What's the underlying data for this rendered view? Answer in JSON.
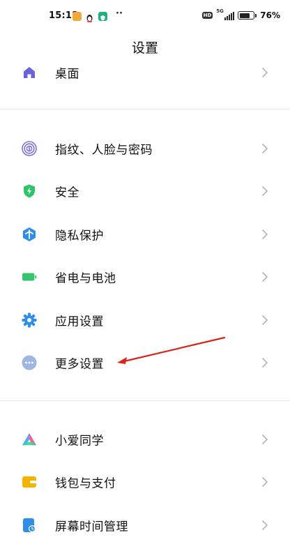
{
  "status_bar": {
    "time": "15:13",
    "dots": "··",
    "hd": "HD",
    "network": "5G",
    "battery_percent": "76%",
    "battery_level": 0.76
  },
  "page": {
    "title": "设置"
  },
  "settings_items": [
    {
      "label": "桌面",
      "icon": "home-icon"
    },
    {
      "label": "指纹、人脸与密码",
      "icon": "fingerprint-icon"
    },
    {
      "label": "安全",
      "icon": "shield-icon"
    },
    {
      "label": "隐私保护",
      "icon": "privacy-icon"
    },
    {
      "label": "省电与电池",
      "icon": "battery-icon"
    },
    {
      "label": "应用设置",
      "icon": "gear-icon"
    },
    {
      "label": "更多设置",
      "icon": "more-icon"
    },
    {
      "label": "小爱同学",
      "icon": "xiaoai-icon"
    },
    {
      "label": "钱包与支付",
      "icon": "wallet-icon"
    },
    {
      "label": "屏幕时间管理",
      "icon": "screen-time-icon"
    }
  ],
  "colors": {
    "home": "#6b63d9",
    "fingerprint": "#7b72e0",
    "shield": "#2ec46c",
    "privacy": "#2f8fe8",
    "battery": "#34c66e",
    "gear": "#2f8fe8",
    "more": "#9fb6e0",
    "wallet": "#f5b300",
    "screen_time": "#2f8fe8",
    "annotation_arrow": "#d8241c",
    "chevron": "#b8b8b8"
  }
}
